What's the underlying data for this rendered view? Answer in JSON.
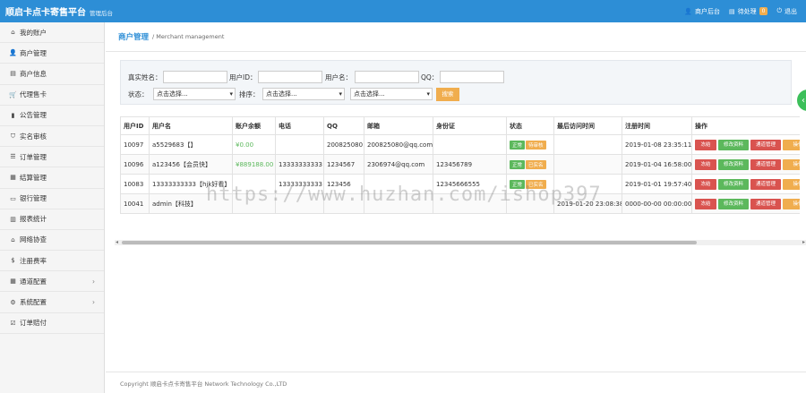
{
  "header": {
    "brand": "顺启卡点卡寄售平台",
    "subtitle": "管理后台",
    "links": [
      {
        "icon": "user-icon",
        "glyph": "👤",
        "label": "商户后台"
      },
      {
        "icon": "list-icon",
        "glyph": "▤",
        "label": "待处理",
        "badge": "0"
      },
      {
        "icon": "power-icon",
        "glyph": "⏻",
        "label": "退出"
      }
    ]
  },
  "sidebar": {
    "items": [
      {
        "icon": "home-icon",
        "glyph": "⌂",
        "label": "我的账户"
      },
      {
        "icon": "user-icon",
        "glyph": "👤",
        "label": "商户管理"
      },
      {
        "icon": "id-card-icon",
        "glyph": "▤",
        "label": "商户信息"
      },
      {
        "icon": "cart-icon",
        "glyph": "🛒",
        "label": "代理售卡"
      },
      {
        "icon": "book-icon",
        "glyph": "▮",
        "label": "公告管理"
      },
      {
        "icon": "shield-icon",
        "glyph": "⛉",
        "label": "实名审核"
      },
      {
        "icon": "list-icon",
        "glyph": "☰",
        "label": "订单管理"
      },
      {
        "icon": "settle-icon",
        "glyph": "▦",
        "label": "结算管理"
      },
      {
        "icon": "bank-card-icon",
        "glyph": "▭",
        "label": "银行管理"
      },
      {
        "icon": "report-icon",
        "glyph": "▥",
        "label": "报表统计"
      },
      {
        "icon": "institution-icon",
        "glyph": "⌂",
        "label": "网络协查"
      },
      {
        "icon": "dollar-icon",
        "glyph": "$",
        "label": "注册费率"
      },
      {
        "icon": "grid-icon",
        "glyph": "▦",
        "label": "通道配置",
        "chevron": "›"
      },
      {
        "icon": "gear-icon",
        "glyph": "⚙",
        "label": "系统配置",
        "chevron": "›"
      },
      {
        "icon": "checkbox-icon",
        "glyph": "☑",
        "label": "订单赔付"
      }
    ]
  },
  "page": {
    "title": "商户管理",
    "breadcrumb": "/ Merchant management"
  },
  "filters": {
    "realname_label": "真实姓名：",
    "realname_value": "",
    "userid_label": "用户ID：",
    "userid_value": "",
    "username_label": "用户名：",
    "username_value": "",
    "qq_label": "QQ：",
    "qq_value": "",
    "status_label": "状态：",
    "status_value": "点击选择...",
    "sort_label": "排序：",
    "sort_value": "点击选择...",
    "sort2_value": "点击选择...",
    "search_button": "搜索"
  },
  "table": {
    "headers": [
      "用户ID",
      "用户名",
      "账户余额",
      "电话",
      "QQ",
      "邮箱",
      "身份证",
      "状态",
      "最后访问时间",
      "注册时间",
      "操作"
    ],
    "rows": [
      {
        "id": "10097",
        "username": "a5529683【】",
        "balance": "¥0.00",
        "phone": "",
        "qq": "200825080",
        "email": "200825080@qq.com",
        "idcard": "",
        "status": [
          "正常",
          "待审核"
        ],
        "last_visit": "",
        "reg_time": "2019-01-08 23:35:11"
      },
      {
        "id": "10096",
        "username": "a123456【会员快】",
        "balance": "¥889188.00",
        "phone": "13333333333",
        "qq": "1234567",
        "email": "2306974@qq.com",
        "idcard": "123456789",
        "status": [
          "正常",
          "已实名"
        ],
        "last_visit": "",
        "reg_time": "2019-01-04 16:58:00"
      },
      {
        "id": "10083",
        "username": "13333333333【hjk好看】",
        "balance": "",
        "phone": "13333333333",
        "qq": "123456",
        "email": "",
        "idcard": "12345666555",
        "status": [
          "正常",
          "已实名"
        ],
        "last_visit": "",
        "reg_time": "2019-01-01 19:57:40"
      },
      {
        "id": "10041",
        "username": "admin【科技】",
        "balance": "",
        "phone": "",
        "qq": "",
        "email": "",
        "idcard": "",
        "status": [],
        "last_visit": "2019-01-20 23:08:38",
        "reg_time": "0000-00-00 00:00:00"
      }
    ],
    "actions": [
      {
        "label": "冻结",
        "color": "#d9534f"
      },
      {
        "label": "修改资料",
        "color": "#5cb85c"
      },
      {
        "label": "通道管理",
        "color": "#d9534f"
      },
      {
        "label": "操作",
        "color": "#f0ad4e"
      }
    ]
  },
  "footer": {
    "copyright": "Copyright 顺启卡点卡寄售平台 Network Technology Co.,LTD"
  },
  "watermark": "https://www.huzhan.com/ishop397",
  "colors": {
    "primary": "#2d8ed6",
    "success": "#5cb85c",
    "warning": "#f0ad4e",
    "danger": "#d9534f"
  }
}
